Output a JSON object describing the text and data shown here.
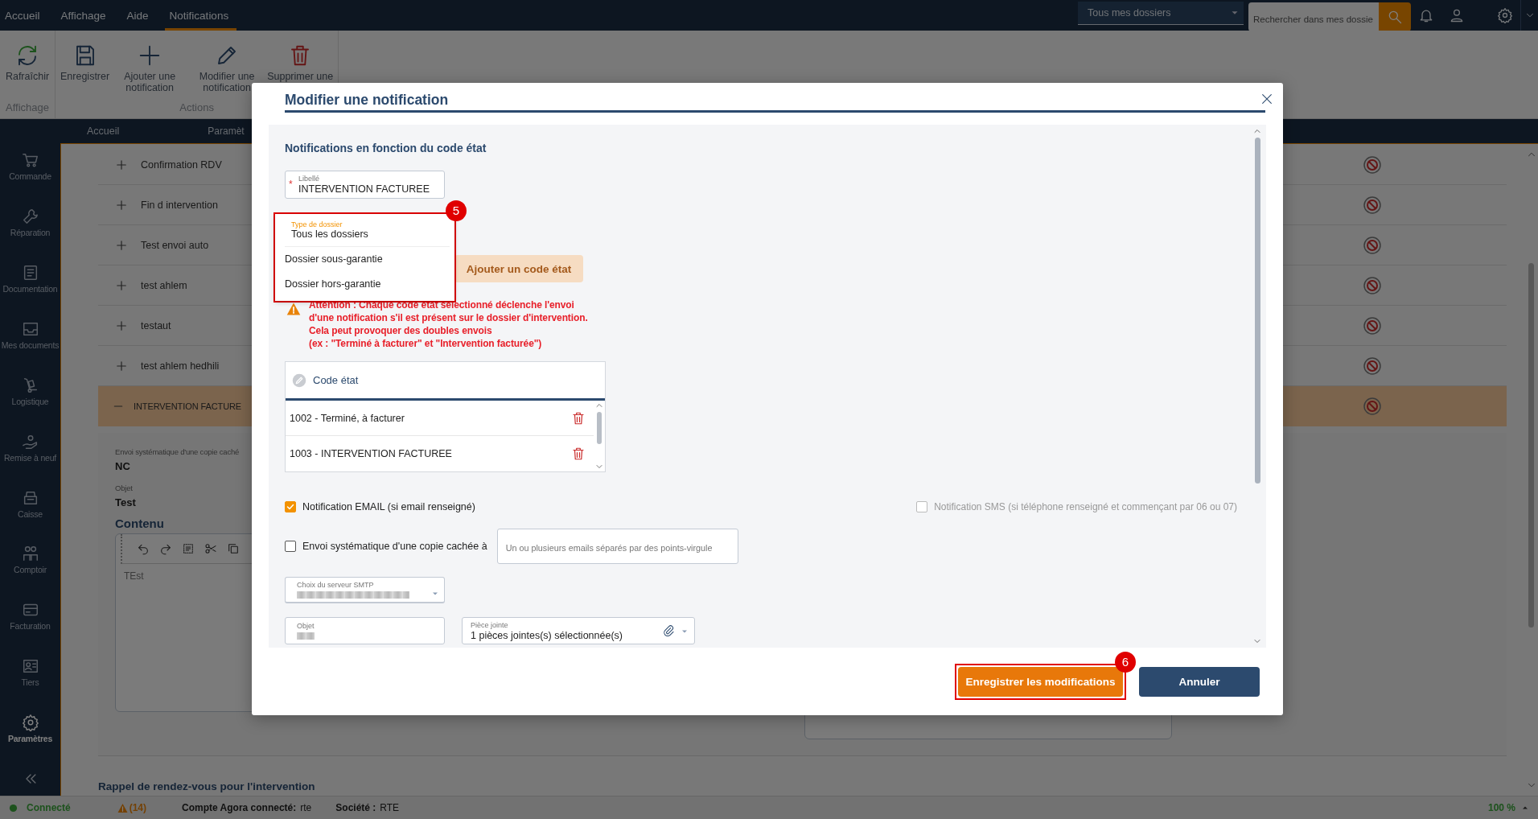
{
  "menu_bar": {
    "items": [
      {
        "label": "Accueil",
        "selected": false
      },
      {
        "label": "Affichage",
        "selected": false
      },
      {
        "label": "Aide",
        "selected": false
      },
      {
        "label": "Notifications",
        "selected": true
      }
    ],
    "folder_filter": {
      "value": "Tous mes dossiers"
    },
    "search": {
      "placeholder": "Rechercher dans mes dossie"
    }
  },
  "ribbon": {
    "groups": [
      {
        "label": "Affichage",
        "buttons": [
          {
            "label": "Rafraîchir"
          }
        ]
      },
      {
        "label": "Actions",
        "buttons": [
          {
            "label": "Enregistrer"
          },
          {
            "label": "Ajouter une notification"
          },
          {
            "label": "Modifier une notification"
          },
          {
            "label": "Supprimer une"
          }
        ]
      }
    ]
  },
  "page_tabs": [
    {
      "label": "Accueil"
    },
    {
      "label": "Paramèt"
    }
  ],
  "sidebar": {
    "items": [
      {
        "label": "Commande",
        "selected": false
      },
      {
        "label": "Réparation",
        "selected": false
      },
      {
        "label": "Documentation",
        "selected": false
      },
      {
        "label": "Mes documents",
        "selected": false
      },
      {
        "label": "Logistique",
        "selected": false
      },
      {
        "label": "Remise à neuf",
        "selected": false
      },
      {
        "label": "Caisse",
        "selected": false
      },
      {
        "label": "Comptoir",
        "selected": false
      },
      {
        "label": "Facturation",
        "selected": false
      },
      {
        "label": "Tiers",
        "selected": false
      },
      {
        "label": "Paramètres",
        "selected": true
      }
    ]
  },
  "notification_list": {
    "rows": [
      {
        "label": "Confirmation RDV",
        "expanded": false
      },
      {
        "label": "Fin d intervention",
        "expanded": false
      },
      {
        "label": "Test envoi auto",
        "expanded": false
      },
      {
        "label": "test ahlem",
        "expanded": false
      },
      {
        "label": "testaut",
        "expanded": false
      },
      {
        "label": "test ahlem hedhili",
        "expanded": false
      },
      {
        "label": "INTERVENTION FACTURE",
        "expanded": true
      }
    ]
  },
  "detail": {
    "fields": [
      {
        "label": "Envoi systématique d'une copie caché",
        "value": "NC"
      },
      {
        "label": "Objet",
        "value": "Test"
      }
    ],
    "content_heading": "Contenu",
    "editor_text": "TEst"
  },
  "next_section_title": "Rappel de rendez-vous pour l'intervention",
  "modal": {
    "title": "Modifier une notification",
    "section_title": "Notifications en fonction du code état",
    "label_field": {
      "label": "Libellé",
      "value": "INTERVENTION FACTUREE",
      "required_mark": "*"
    },
    "type_dropdown": {
      "label": "Type de dossier",
      "value": "Tous les dossiers",
      "expanded": true,
      "options": [
        "Dossier sous-garantie",
        "Dossier hors-garantie"
      ],
      "annotation": "5"
    },
    "add_code_button": {
      "label": "Ajouter un code état",
      "disabled": true
    },
    "warning": "Attention : Chaque code état sélectionné déclenche l'envoi\nd'une notification s'il est présent sur le dossier d'intervention.\nCela peut provoquer des doubles envois\n(ex : \"Terminé à facturer\" et \"Intervention facturée\")",
    "code_table": {
      "header": "Code état",
      "rows": [
        "1002 - Terminé, à facturer",
        "1003 - INTERVENTION FACTUREE"
      ]
    },
    "email_notification": {
      "label": "Notification EMAIL (si email renseigné)",
      "checked": true,
      "disabled": false
    },
    "sms_notification": {
      "label": "Notification SMS (si téléphone renseigné et commençant par 06 ou 07)",
      "checked": false,
      "disabled": true
    },
    "bcc": {
      "label": "Envoi systématique d'une copie cachée à",
      "checked": false,
      "disabled": false,
      "placeholder": "Un ou plusieurs emails séparés par des points-virgule"
    },
    "smtp_select": {
      "label": "Choix du serveur SMTP",
      "value_redacted": true
    },
    "subject_field": {
      "label": "Objet",
      "value_redacted": true
    },
    "attachment_field": {
      "label": "Pièce jointe",
      "value": "1 pièces jointes(s) sélectionnée(s)"
    },
    "buttons": [
      {
        "label": "Enregistrer les modifications",
        "kind": "primary",
        "annotation": "6"
      },
      {
        "label": "Annuler",
        "kind": "secondary"
      }
    ]
  },
  "status_bar": {
    "connection": "Connecté",
    "warnings": "(14)",
    "account_label": "Compte Agora connecté:",
    "account": "rte",
    "company_label": "Société :",
    "company": "RTE",
    "zoom": "100 %"
  }
}
